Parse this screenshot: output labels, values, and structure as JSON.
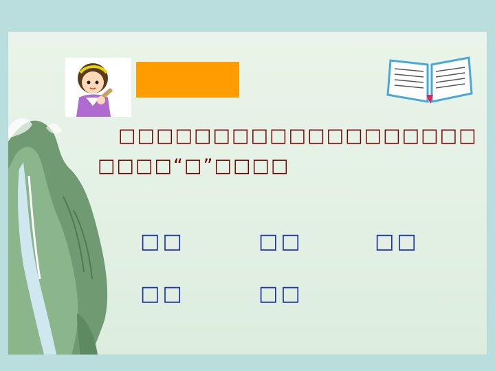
{
  "slide": {
    "colors": {
      "background": "#b9dedd",
      "panel": "#e6f2e6",
      "accent": "#ff9c00",
      "text": "#7a0000",
      "words": "#1a2fb5"
    },
    "icons": [
      "girl-reading-icon",
      "open-book-icon",
      "mountain-waterfall-illustration"
    ],
    "instruction": {
      "line1": "□□□□□□□□□□□□□□□□□□□",
      "line2": "□□□□“□”□□□□"
    },
    "words": {
      "w1": "□□",
      "w2": "□□",
      "w3": "□□",
      "w4": "□□",
      "w5": "□□"
    }
  }
}
